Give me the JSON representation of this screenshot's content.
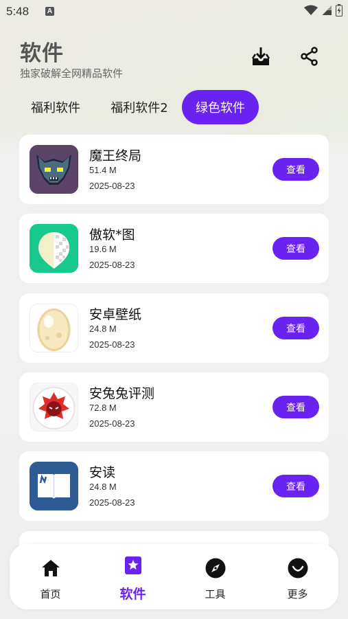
{
  "status_bar": {
    "time": "5:48",
    "notification_letter": "A"
  },
  "header": {
    "title": "软件",
    "subtitle": "独家破解全网精品软件",
    "download_icon": "download-tray-icon",
    "share_icon": "share-icon"
  },
  "tabs": [
    {
      "label": "福利软件",
      "active": false
    },
    {
      "label": "福利软件2",
      "active": false
    },
    {
      "label": "绿色软件",
      "active": true
    }
  ],
  "apps": [
    {
      "name": "魔王终局",
      "size": "51.4 M",
      "date": "2025-08-23",
      "button": "查看",
      "icon": "demon-mask-app-icon"
    },
    {
      "name": "傲软*图",
      "size": "19.6 M",
      "date": "2025-08-23",
      "button": "查看",
      "icon": "cutout-leaf-app-icon"
    },
    {
      "name": "安卓壁纸",
      "size": "24.8 M",
      "date": "2025-08-23",
      "button": "查看",
      "icon": "egg-app-icon"
    },
    {
      "name": "安兔兔评测",
      "size": "72.8 M",
      "date": "2025-08-23",
      "button": "查看",
      "icon": "antutu-app-icon"
    },
    {
      "name": "安读",
      "size": "24.8 M",
      "date": "2025-08-23",
      "button": "查看",
      "icon": "book-app-icon"
    }
  ],
  "bottom_nav": [
    {
      "label": "首页",
      "icon": "home-icon",
      "active": false
    },
    {
      "label": "软件",
      "icon": "star-bookmark-icon",
      "active": true
    },
    {
      "label": "工具",
      "icon": "compass-icon",
      "active": false
    },
    {
      "label": "更多",
      "icon": "smile-icon",
      "active": false
    }
  ],
  "colors": {
    "accent": "#6a22f0",
    "card": "#ffffff",
    "page": "#f0f0f0"
  }
}
